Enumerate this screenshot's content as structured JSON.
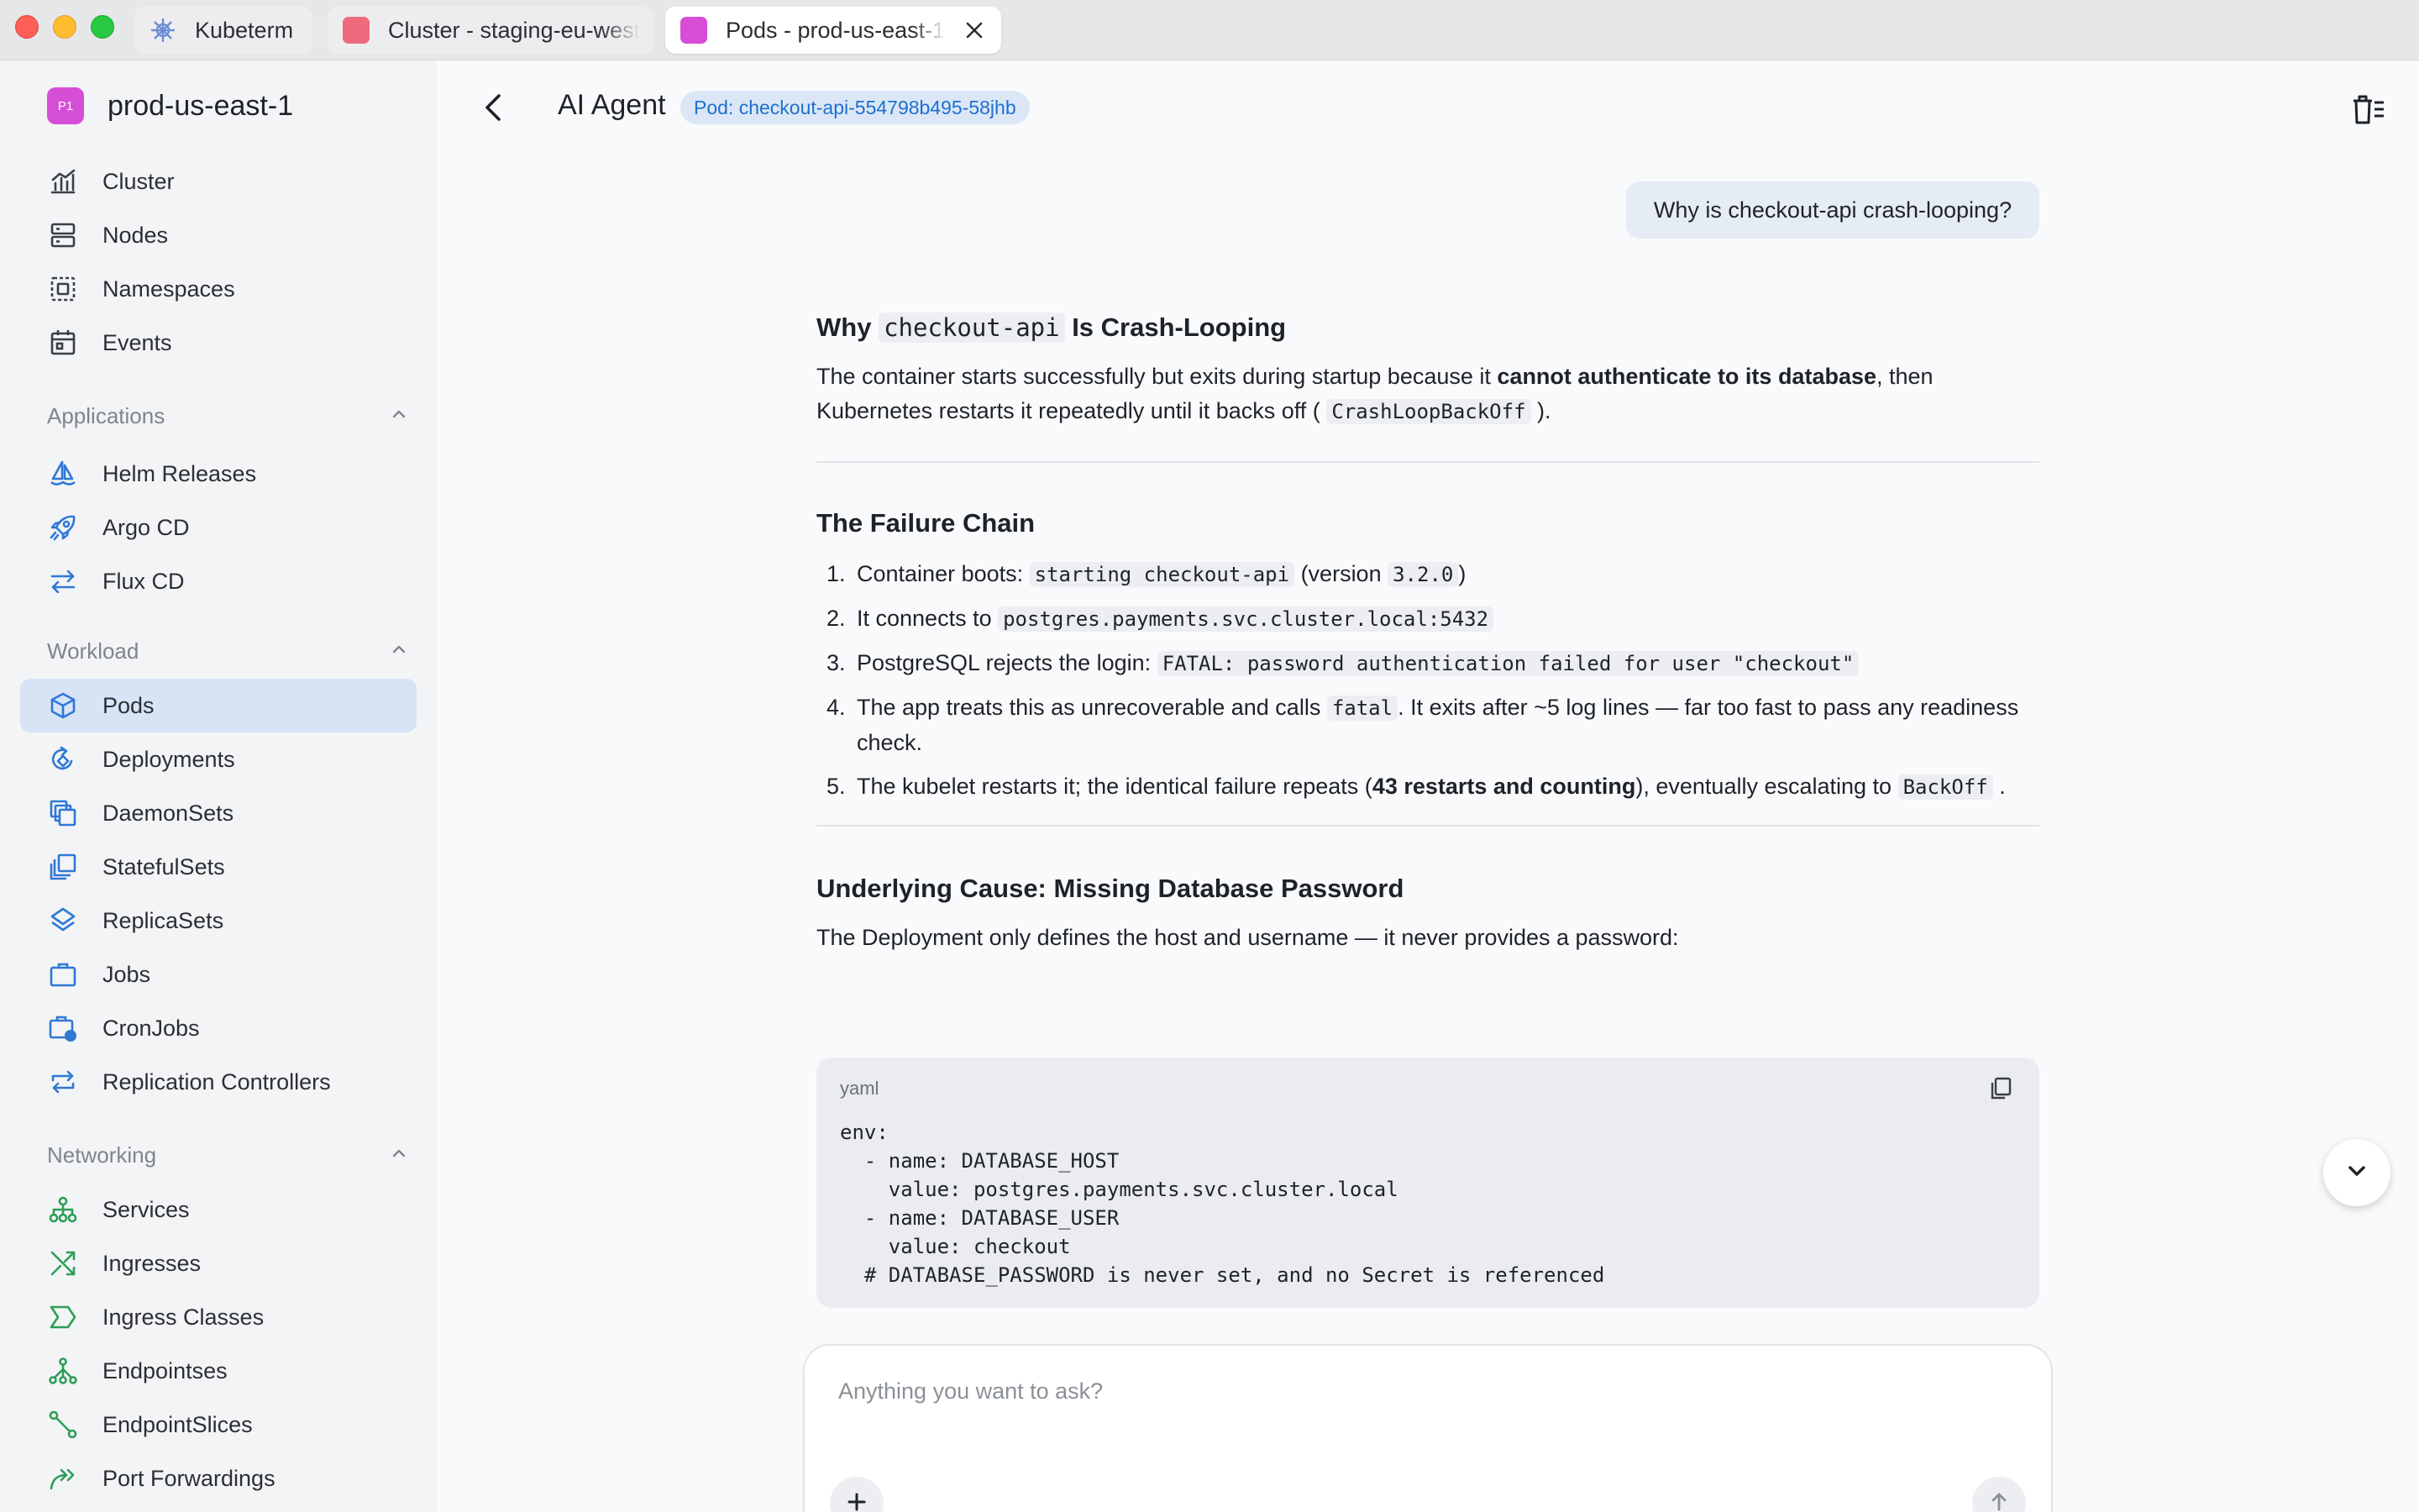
{
  "tabs": [
    {
      "label": "Kubeterm",
      "icon": "helm-wheel-icon"
    },
    {
      "label": "Cluster - staging-eu-west",
      "icon": "cluster-color-icon",
      "color": "#ee6b7d"
    },
    {
      "label": "Pods - prod-us-east-1",
      "icon": "cluster-color-icon",
      "color": "#d64ed6"
    }
  ],
  "sidebar": {
    "cluster_badge": "P1",
    "cluster_name": "prod-us-east-1",
    "top_items": [
      "Cluster",
      "Nodes",
      "Namespaces",
      "Events"
    ],
    "applications_title": "Applications",
    "applications_items": [
      "Helm Releases",
      "Argo CD",
      "Flux CD"
    ],
    "workload_title": "Workload",
    "workload_items": [
      "Pods",
      "Deployments",
      "DaemonSets",
      "StatefulSets",
      "ReplicaSets",
      "Jobs",
      "CronJobs",
      "Replication Controllers"
    ],
    "networking_title": "Networking",
    "networking_items": [
      "Services",
      "Ingresses",
      "Ingress Classes",
      "Endpointses",
      "EndpointSlices",
      "Port Forwardings"
    ]
  },
  "header": {
    "title": "AI Agent",
    "pod_chip": "Pod: checkout-api-554798b495-58jhb"
  },
  "chat": {
    "user_message": "Why is checkout-api crash-looping?",
    "h1_pre": "Why ",
    "h1_code": "checkout-api",
    "h1_post": " Is Crash-Looping",
    "p1_a": "The container starts successfully but exits during startup because it ",
    "p1_b": "cannot authenticate to its database",
    "p1_c": ", then Kubernetes restarts it repeatedly until it backs off (",
    "p1_code": "CrashLoopBackOff",
    "p1_d": ").",
    "h2": "The Failure Chain",
    "steps": [
      {
        "num": "1.",
        "a": "Container boots: ",
        "code1": "starting checkout-api",
        "b": " (version ",
        "code2": "3.2.0",
        "c": ")"
      },
      {
        "num": "2.",
        "a": "It connects to ",
        "code1": "postgres.payments.svc.cluster.local:5432"
      },
      {
        "num": "3.",
        "a": "PostgreSQL rejects the login: ",
        "code1": "FATAL: password authentication failed for user \"checkout\""
      },
      {
        "num": "4.",
        "a": "The app treats this as unrecoverable and calls ",
        "code1": "fatal",
        "b": ". It exits after ~5 log lines — far too fast to pass any readiness check."
      },
      {
        "num": "5.",
        "a": "The kubelet restarts it; the identical failure repeats (",
        "bold": "43 restarts and counting",
        "b": "), eventually escalating to ",
        "code1": "BackOff",
        "c": "."
      }
    ],
    "h3": "Underlying Cause: Missing Database Password",
    "p3": "The Deployment only defines the host and username — it never provides a password:",
    "code_lang": "yaml",
    "code_lines": [
      "env:",
      "  - name: DATABASE_HOST",
      "    value: postgres.payments.svc.cluster.local",
      "  - name: DATABASE_USER",
      "    value: checkout",
      "  # DATABASE_PASSWORD is never set, and no Secret is referenced"
    ]
  },
  "composer": {
    "placeholder": "Anything you want to ask?",
    "value": ""
  },
  "colors": {
    "accent": "#1f6fcf",
    "active_nav": "#d6e4f6",
    "cluster_badge": "#d54fd6"
  }
}
